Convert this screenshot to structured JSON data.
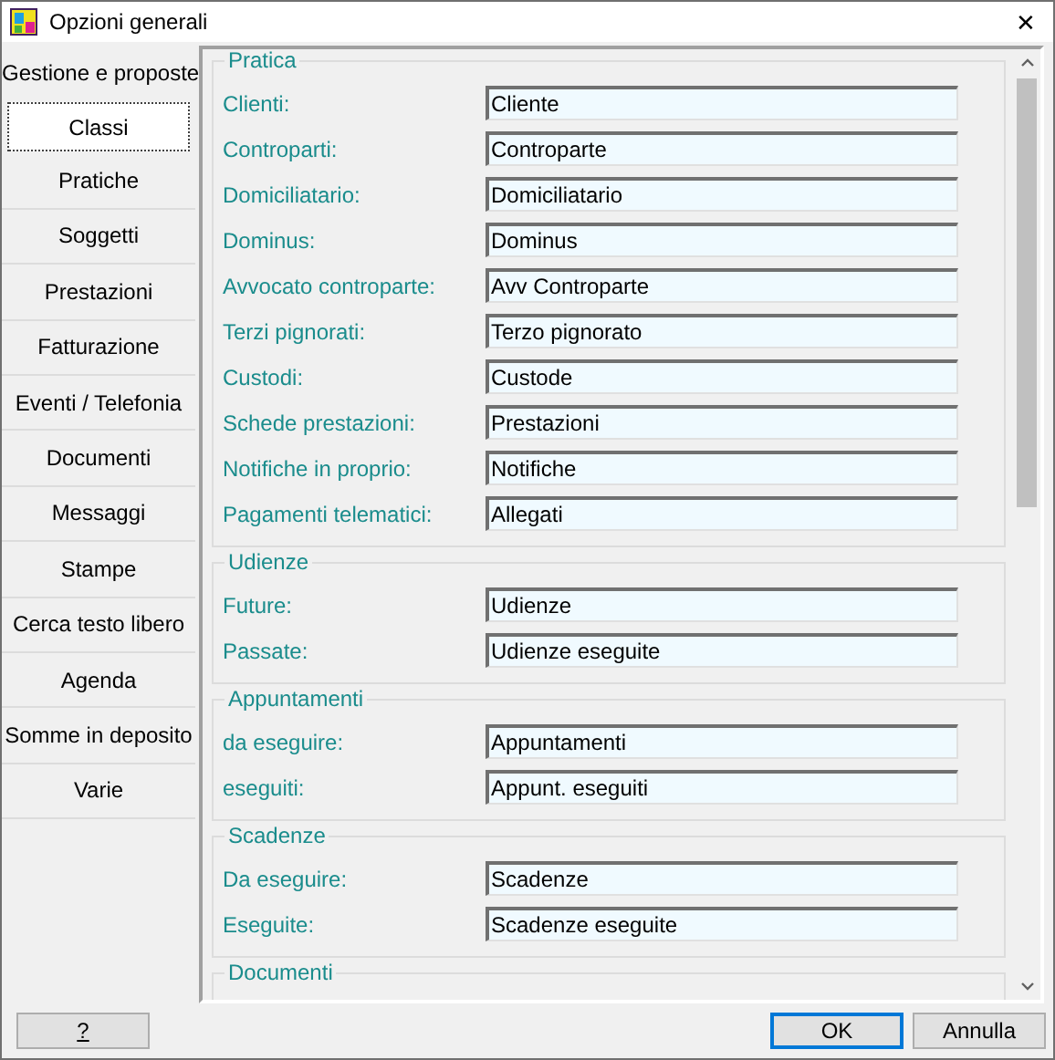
{
  "window": {
    "title": "Opzioni generali",
    "close": "✕"
  },
  "sidebar": {
    "items": [
      {
        "label": "Gestione e proposte",
        "selected": false
      },
      {
        "label": "Classi",
        "selected": true
      },
      {
        "label": "Pratiche",
        "selected": false
      },
      {
        "label": "Soggetti",
        "selected": false
      },
      {
        "label": "Prestazioni",
        "selected": false
      },
      {
        "label": "Fatturazione",
        "selected": false
      },
      {
        "label": "Eventi / Telefonia",
        "selected": false
      },
      {
        "label": "Documenti",
        "selected": false
      },
      {
        "label": "Messaggi",
        "selected": false
      },
      {
        "label": "Stampe",
        "selected": false
      },
      {
        "label": "Cerca testo libero",
        "selected": false
      },
      {
        "label": "Agenda",
        "selected": false
      },
      {
        "label": "Somme in deposito",
        "selected": false
      },
      {
        "label": "Varie",
        "selected": false
      }
    ]
  },
  "groups": [
    {
      "title": "Pratica",
      "fields": [
        {
          "label": "Clienti:",
          "value": "Cliente"
        },
        {
          "label": "Controparti:",
          "value": "Controparte"
        },
        {
          "label": "Domiciliatario:",
          "value": "Domiciliatario"
        },
        {
          "label": "Dominus:",
          "value": "Dominus"
        },
        {
          "label": "Avvocato controparte:",
          "value": "Avv Controparte"
        },
        {
          "label": "Terzi pignorati:",
          "value": "Terzo pignorato"
        },
        {
          "label": "Custodi:",
          "value": "Custode"
        },
        {
          "label": "Schede prestazioni:",
          "value": "Prestazioni"
        },
        {
          "label": "Notifiche in proprio:",
          "value": "Notifiche"
        },
        {
          "label": "Pagamenti telematici:",
          "value": "Allegati"
        }
      ]
    },
    {
      "title": "Udienze",
      "fields": [
        {
          "label": "Future:",
          "value": "Udienze"
        },
        {
          "label": "Passate:",
          "value": "Udienze eseguite"
        }
      ]
    },
    {
      "title": "Appuntamenti",
      "fields": [
        {
          "label": "da eseguire:",
          "value": "Appuntamenti"
        },
        {
          "label": "eseguiti:",
          "value": "Appunt. eseguiti"
        }
      ]
    },
    {
      "title": "Scadenze",
      "fields": [
        {
          "label": "Da eseguire:",
          "value": "Scadenze"
        },
        {
          "label": "Eseguite:",
          "value": "Scadenze eseguite"
        }
      ]
    },
    {
      "title": "Documenti"
    }
  ],
  "footer": {
    "help": "?",
    "ok": "OK",
    "cancel": "Annulla"
  }
}
